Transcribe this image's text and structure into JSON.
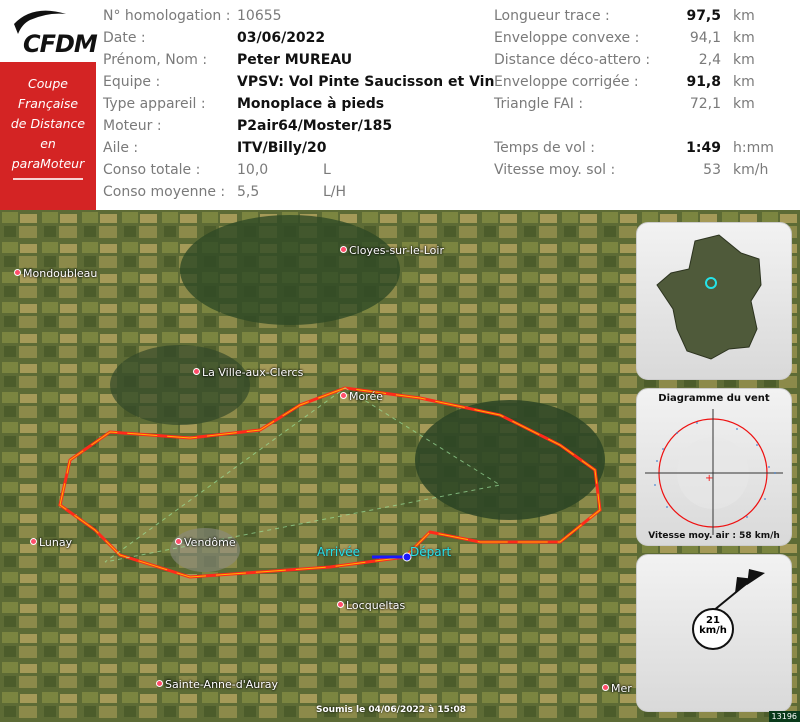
{
  "logo": {
    "text": "CFDM"
  },
  "banner": {
    "lines": [
      "Coupe",
      "Française",
      "de Distance",
      "en",
      "paraMoteur"
    ]
  },
  "info": {
    "homologation_label": "N° homologation :",
    "homologation_value": "10655",
    "date_label": "Date :",
    "date_value": "03/06/2022",
    "name_label": "Prénom, Nom :",
    "name_value": "Peter MUREAU",
    "team_label": "Equipe :",
    "team_value": "VPSV: Vol Pinte Saucisson et Vin",
    "aircraft_label": "Type appareil :",
    "aircraft_value": "Monoplace à pieds",
    "engine_label": "Moteur :",
    "engine_value": "P2air64/Moster/185",
    "wing_label": "Aile :",
    "wing_value": "ITV/Billy/20",
    "conso_total_label": "Conso totale :",
    "conso_total_value": "10,0",
    "conso_total_unit": "L",
    "conso_avg_label": "Conso moyenne :",
    "conso_avg_value": "5,5",
    "conso_avg_unit": "L/H"
  },
  "stats": {
    "track_label": "Longueur trace :",
    "track_value": "97,5",
    "track_unit": "km",
    "hull_label": "Enveloppe convexe :",
    "hull_value": "94,1",
    "hull_unit": "km",
    "deco_label": "Distance déco-attero :",
    "deco_value": "2,4",
    "deco_unit": "km",
    "corr_label": "Enveloppe corrigée :",
    "corr_value": "91,8",
    "corr_unit": "km",
    "fai_label": "Triangle FAI :",
    "fai_value": "72,1",
    "fai_unit": "km",
    "time_label": "Temps de vol :",
    "time_value": "1:49",
    "time_unit": "h:mm",
    "speed_label": "Vitesse moy. sol :",
    "speed_value": "53",
    "speed_unit": "km/h"
  },
  "map": {
    "towns": [
      "Cloyes-sur-le-Loir",
      "Mondoubleau",
      "La Ville-aux-Clercs",
      "Morée",
      "Lunay",
      "Vendôme",
      "Locqueltas",
      "Sainte-Anne-d'Auray",
      "Mer"
    ],
    "arrival_label": "Arrivée",
    "departure_label": "Départ",
    "footer": "Soumis le 04/06/2022 à 15:08",
    "image_id": "13196"
  },
  "wind_panel": {
    "title": "Diagramme du vent",
    "footer": "Vitesse moy. air : 58 km/h"
  },
  "wind_gauge": {
    "speed": "21",
    "unit": "km/h"
  }
}
